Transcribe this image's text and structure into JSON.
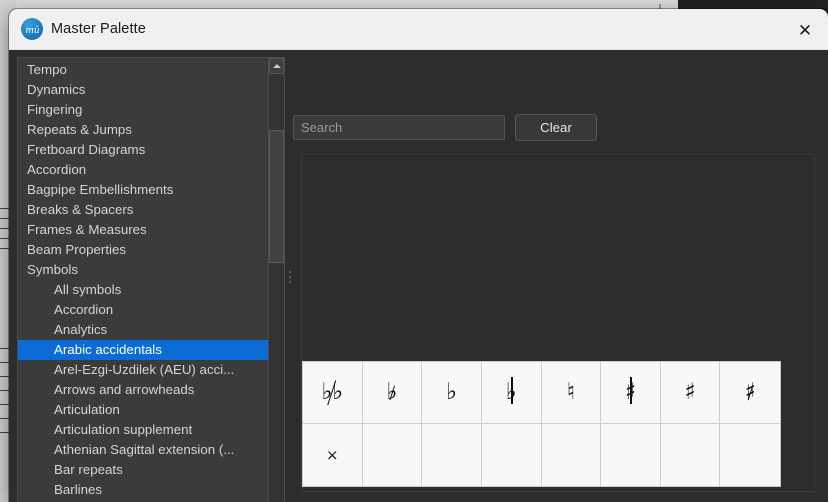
{
  "window": {
    "title": "Master Palette",
    "logo_icon": "musescore-logo-icon",
    "close_icon": "close-icon",
    "close_label": "✕"
  },
  "palette_list": {
    "items": [
      {
        "label": "Tempo",
        "level": 0,
        "selected": false
      },
      {
        "label": "Dynamics",
        "level": 0,
        "selected": false
      },
      {
        "label": "Fingering",
        "level": 0,
        "selected": false
      },
      {
        "label": "Repeats & Jumps",
        "level": 0,
        "selected": false
      },
      {
        "label": "Fretboard Diagrams",
        "level": 0,
        "selected": false
      },
      {
        "label": "Accordion",
        "level": 0,
        "selected": false
      },
      {
        "label": "Bagpipe Embellishments",
        "level": 0,
        "selected": false
      },
      {
        "label": "Breaks & Spacers",
        "level": 0,
        "selected": false
      },
      {
        "label": "Frames & Measures",
        "level": 0,
        "selected": false
      },
      {
        "label": "Beam Properties",
        "level": 0,
        "selected": false
      },
      {
        "label": "Symbols",
        "level": 0,
        "selected": false
      },
      {
        "label": "All symbols",
        "level": 1,
        "selected": false
      },
      {
        "label": "Accordion",
        "level": 1,
        "selected": false
      },
      {
        "label": "Analytics",
        "level": 1,
        "selected": false
      },
      {
        "label": "Arabic accidentals",
        "level": 1,
        "selected": true
      },
      {
        "label": "Arel-Ezgi-Uzdilek (AEU) acci...",
        "level": 1,
        "selected": false
      },
      {
        "label": "Arrows and arrowheads",
        "level": 1,
        "selected": false
      },
      {
        "label": "Articulation",
        "level": 1,
        "selected": false
      },
      {
        "label": "Articulation supplement",
        "level": 1,
        "selected": false
      },
      {
        "label": "Athenian Sagittal extension (...",
        "level": 1,
        "selected": false
      },
      {
        "label": "Bar repeats",
        "level": 1,
        "selected": false
      },
      {
        "label": "Barlines",
        "level": 1,
        "selected": false
      }
    ],
    "scroll_up_icon": "scroll-up-arrow-icon",
    "scrollbar_name": "palette-list-scrollbar"
  },
  "search": {
    "value": "",
    "placeholder": "Search",
    "clear_label": "Clear"
  },
  "symbols": {
    "columns": 8,
    "cells": [
      {
        "name": "arabic-double-flat",
        "glyph": "♭♭",
        "style": "slashed-double-flat"
      },
      {
        "name": "arabic-slashed-flat",
        "glyph": "♭",
        "style": "slashed-flat"
      },
      {
        "name": "arabic-flat",
        "glyph": "♭",
        "style": "plain"
      },
      {
        "name": "arabic-half-flat",
        "glyph": "♭",
        "style": "mirrored-flat"
      },
      {
        "name": "arabic-natural",
        "glyph": "♮",
        "style": "plain"
      },
      {
        "name": "arabic-half-sharp",
        "glyph": "♯",
        "style": "half-sharp"
      },
      {
        "name": "arabic-sharp",
        "glyph": "♯",
        "style": "plain"
      },
      {
        "name": "arabic-double-sharp-hash",
        "glyph": "♯",
        "style": "slashed-sharp"
      },
      {
        "name": "arabic-double-sharp-x",
        "glyph": "×",
        "style": "small"
      },
      {
        "name": "empty-cell",
        "glyph": "",
        "style": "empty"
      },
      {
        "name": "empty-cell",
        "glyph": "",
        "style": "empty"
      },
      {
        "name": "empty-cell",
        "glyph": "",
        "style": "empty"
      },
      {
        "name": "empty-cell",
        "glyph": "",
        "style": "empty"
      },
      {
        "name": "empty-cell",
        "glyph": "",
        "style": "empty"
      },
      {
        "name": "empty-cell",
        "glyph": "",
        "style": "empty"
      },
      {
        "name": "empty-cell",
        "glyph": "",
        "style": "empty"
      }
    ]
  },
  "colors": {
    "accent": "#0a6cd4",
    "dialog_bg": "#2d2d2d",
    "titlebar_bg": "#f0f0f0",
    "list_bg": "#3b3b3b",
    "grid_bg": "#f8f8f8"
  }
}
